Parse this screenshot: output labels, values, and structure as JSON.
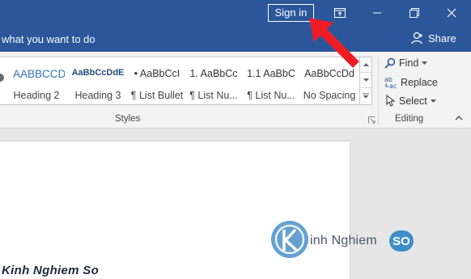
{
  "titlebar": {
    "sign_in_label": "Sign in",
    "color": "#2b579a"
  },
  "tellbar": {
    "tell_me_text": "what you want to do",
    "share_label": "Share"
  },
  "ribbon": {
    "styles": [
      {
        "preview": "AABBCCDD",
        "name": "Heading 2"
      },
      {
        "preview": "AaBbCcDdE",
        "name": "Heading 3"
      },
      {
        "preview": "• AaBbCcI",
        "name": "¶ List Bullet"
      },
      {
        "preview": "1. AaBbCc",
        "name": "¶ List Nu..."
      },
      {
        "preview": "1.1 AaBbC",
        "name": "¶ List Nu..."
      },
      {
        "preview": "AaBbCcDd",
        "name": "No Spacing"
      }
    ],
    "styles_group_label": "Styles",
    "editing_group_label": "Editing",
    "editing": {
      "find_label": "Find",
      "replace_label": "Replace",
      "select_label": "Select"
    }
  },
  "watermark": {
    "logo_text": "inh Nghiem",
    "logo_badge": "SO",
    "bottom_text": "Kinh Nghiem So"
  }
}
